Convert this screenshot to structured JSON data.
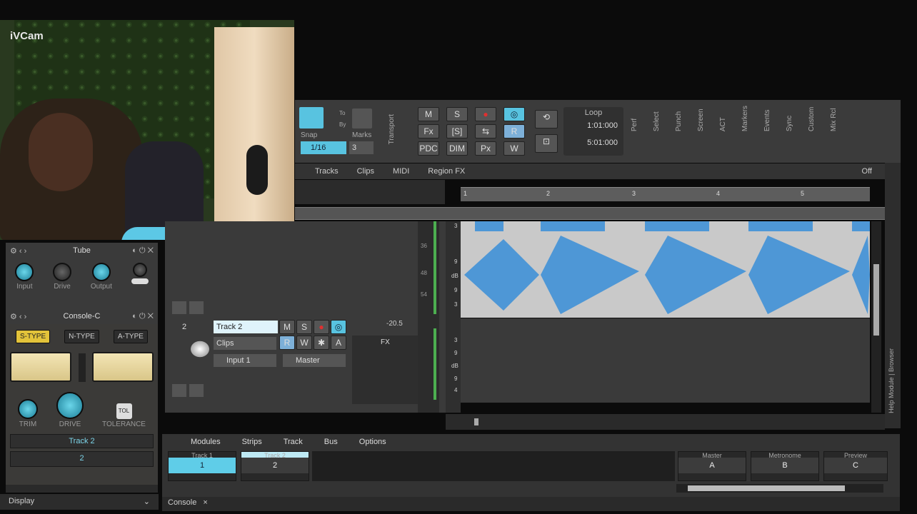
{
  "webcam": {
    "label": "iVCam"
  },
  "rack": {
    "tube": {
      "title": "Tube",
      "knobs": [
        "Input",
        "Drive",
        "Output"
      ]
    },
    "console": {
      "title": "Console-C",
      "types": [
        "S-TYPE",
        "N-TYPE",
        "A-TYPE"
      ],
      "knobs": [
        "TRIM",
        "DRIVE"
      ],
      "tolerance_btn": "TOL",
      "tolerance_label": "TOLERANCE",
      "track_name": "Track 2",
      "track_num": "2"
    }
  },
  "bottom_left": {
    "display": "Display",
    "console_tab": "Console"
  },
  "toolbar": {
    "snap_label": "Snap",
    "snap_value": "1/16",
    "to_label": "To",
    "by_label": "By",
    "marks_label": "Marks",
    "marks_value": "3",
    "transport_label": "Transport",
    "buttons_row1": [
      "M",
      "S",
      "●",
      "◎"
    ],
    "buttons_row2": [
      "Fx",
      "[S]",
      "⇆",
      "R"
    ],
    "buttons_row3": [
      "PDC",
      "DIM",
      "Px",
      "W"
    ],
    "loop_label": "Loop",
    "loop_start": "1:01:000",
    "loop_end": "5:01:000",
    "modules": [
      "Perf",
      "Select",
      "Punch",
      "Screen",
      "ACT",
      "Markers",
      "Events",
      "Sync",
      "Custom",
      "Mix Rcl"
    ]
  },
  "menu": {
    "items": [
      "Tracks",
      "Clips",
      "MIDI",
      "Region FX"
    ],
    "off_label": "Off"
  },
  "ruler": {
    "marks": [
      "1",
      "2",
      "3",
      "4",
      "5"
    ]
  },
  "track2": {
    "number": "2",
    "name": "Track 2",
    "buttons": [
      "M",
      "S",
      "●",
      "◎"
    ],
    "buttons2": [
      "R",
      "W",
      "✱",
      "A"
    ],
    "clips": "Clips",
    "input": "Input 1",
    "output": "Master",
    "volume": "-20.5",
    "fx": "FX"
  },
  "meter_scale": [
    "3",
    "9",
    "dB",
    "9",
    "3"
  ],
  "meter_scale2": [
    "3",
    "9",
    "dB",
    "9",
    "4"
  ],
  "lane_scale": [
    "36",
    "48",
    "54"
  ],
  "console": {
    "menu": [
      "Modules",
      "Strips",
      "Track",
      "Bus",
      "Options"
    ],
    "strips": [
      {
        "top": "Track 1",
        "btn": "1"
      },
      {
        "top": "Track 2",
        "btn": "2"
      }
    ],
    "buses": [
      {
        "top": "Master",
        "btn": "A"
      },
      {
        "top": "Metronome",
        "btn": "B"
      },
      {
        "top": "Preview",
        "btn": "C"
      }
    ]
  },
  "right_panel": {
    "label": "Help Module | Browser"
  }
}
